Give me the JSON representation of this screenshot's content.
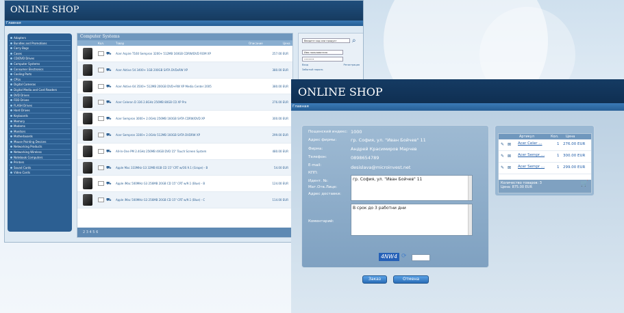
{
  "win1": {
    "title": "ONLINE SHOP",
    "nav": "Главная",
    "sidebar": [
      "Adapters",
      "Bundles and Promotions",
      "Carry Bags",
      "Cases",
      "CD/DVD Drives",
      "Computer Systems",
      "Consumer Electronics",
      "Cooling Parts",
      "CPUs",
      "Digital Cameras",
      "Digital Media and Card Readers",
      "DVD Drives",
      "FDD Drives",
      "FLASH Drives",
      "Hard Drives",
      "Keyboards",
      "Memory",
      "Modems",
      "Monitors",
      "Motherboards",
      "Mouse Pointing Devices",
      "Networking Products",
      "Networking Wireless",
      "Notebook Computers",
      "Printers",
      "Sound Cards",
      "Video Cards"
    ],
    "catalog": {
      "title": "Computer Systems",
      "col_qty": "Кол.",
      "col_item": "Товар",
      "col_desc": "Описание",
      "col_price": "Цена",
      "rows": [
        {
          "name": "Acer Aspire T160 Sempron 3200+ 512MB 160GB CDRW/DVD ROM XP",
          "price": "257.00 EUR"
        },
        {
          "name": "Acer Aktive 54 3400+ 1GB 200GB SATA DVDxRW XP",
          "price": "380.00 EUR"
        },
        {
          "name": "Acer Aktive 64 3500+ 512MB 200GB DVD+RW XP Media Center 2005",
          "price": "380.00 EUR"
        },
        {
          "name": "Acer Celeron D 336 2.8GHz 256MB 80GB CD XP Pro",
          "price": "276.00 EUR"
        },
        {
          "name": "Acer Sempron 3000+ 2.0GHz 256MB 160GB SATA CDRW/DVD XP",
          "price": "300.00 EUR"
        },
        {
          "name": "Acer Sempron 3300+ 2.0GHz 512MB 160GB SATA DVDRW XP",
          "price": "299.00 EUR"
        },
        {
          "name": "All-In-One PM 2.4GHz 256MB 40GB DVD 15\" Touch Screen System",
          "price": "480.00 EUR"
        },
        {
          "name": "Apple Mac 333MHz G3 32MB 6GB CD 15\" CRT w/OS 9.1 (Grape) - B",
          "price": "54.00 EUR"
        },
        {
          "name": "Apple iMac 500MHz G3 256MB 20GB CD 15\" CRT w/9.1 (Blue) - B",
          "price": "124.00 EUR"
        },
        {
          "name": "Apple iMac 500MHz G3 256MB 20GB CD 15\" CRT w/9.1 (Blue) - C",
          "price": "114.00 EUR"
        }
      ],
      "pager": "2 3 4 5 6"
    },
    "login": {
      "search_placeholder": "Введите код или продукт",
      "user_placeholder": "Имя пользователя",
      "password": "•••••••",
      "login_link": "Вход",
      "register_link": "Регистрация",
      "forgot_link": "Забытый пароль"
    }
  },
  "win2": {
    "title": "ONLINE SHOP",
    "nav": "Главная",
    "form": {
      "postal_label": "Пощенский индекс:",
      "postal_value": "1000",
      "company_addr_label": "Адрес фирмы:",
      "company_addr_value": "гр. София, ул. \"Иван Бойчев\" 11",
      "company_label": "Фирма:",
      "company_value": "Андрей Красимиров Марчев",
      "phone_label": "Телефон:",
      "phone_value": "0898654789",
      "email_label": "E-mail:",
      "email_value": "desislava@microinvest.net",
      "kpp_label": "КПП:",
      "ident_label": "Идент. №:",
      "mol_label": "Мат.Отв.Лице:",
      "delivery_label": "Адрес доставки:",
      "delivery_value": "гр. София, ул. \"Иван Бойчев\" 11",
      "comment_label": "Коментарий:",
      "comment_value": "В срок до 3 работни дни",
      "captcha_text": "4NW4",
      "order_button": "Заказ",
      "cancel_button": "Отмена"
    },
    "cart": {
      "col_item": "Артикул",
      "col_qty": "Кол.",
      "col_price": "Цена",
      "rows": [
        {
          "name": "Acer Celer ...",
          "qty": "1",
          "price": "276.00 EUR"
        },
        {
          "name": "Acer Sempr ...",
          "qty": "1",
          "price": "300.00 EUR"
        },
        {
          "name": "Acer Sempr ...",
          "qty": "1",
          "price": "299.00 EUR"
        }
      ],
      "count_text": "Количество товаров: 3",
      "total_text": "Цена: 875.00 EUR"
    }
  }
}
